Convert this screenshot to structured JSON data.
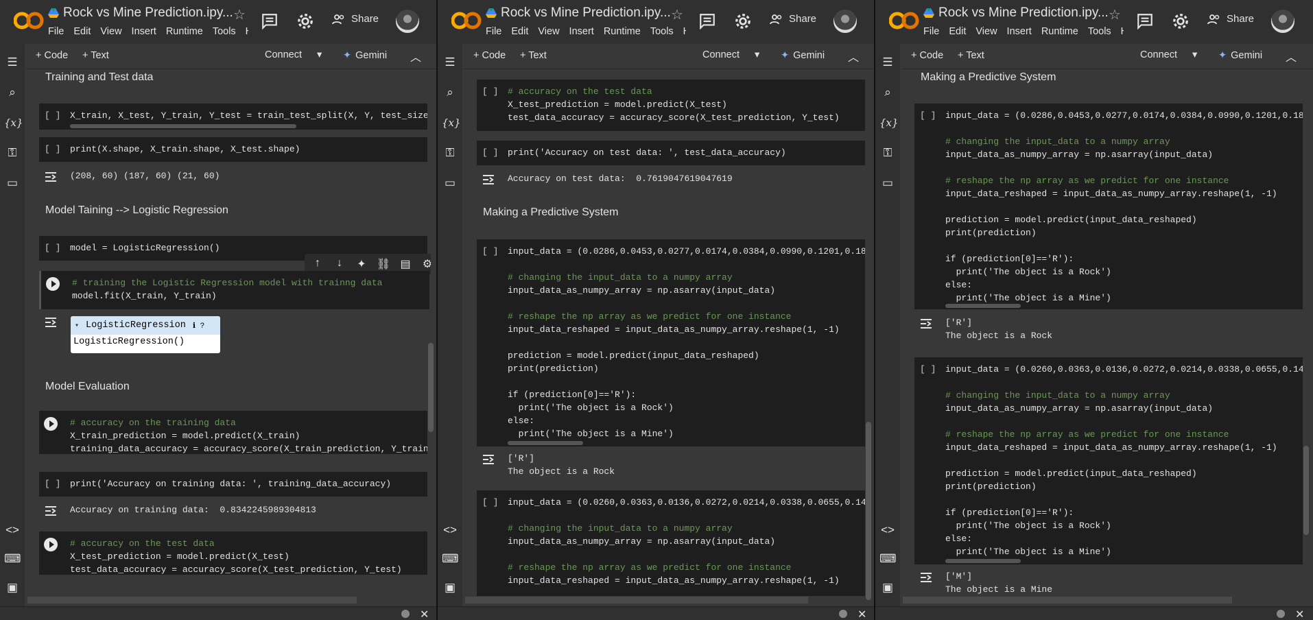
{
  "app": {
    "title": "Rock vs Mine Prediction.ipy...",
    "menu": [
      "File",
      "Edit",
      "View",
      "Insert",
      "Runtime",
      "Tools",
      "H"
    ],
    "share_label": "Share",
    "add_code": "+ Code",
    "add_text": "+ Text",
    "connect": "Connect",
    "gemini": "Gemini"
  },
  "panel1": {
    "sections": [
      "Training and Test data",
      "Model Taining --> Logistic Regression",
      "Model Evaluation"
    ],
    "cells": [
      {
        "bracket": "[ ]",
        "line1": "X_train, X_test, Y_train, Y_test = train_test_split(X, Y, test_size"
      },
      {
        "bracket": "[ ]",
        "line1": "print(X.shape, X_train.shape, X_test.shape)",
        "output": "(208, 60) (187, 60) (21, 60)"
      },
      {
        "bracket": "[ ]",
        "line1": "model = LogisticRegression()"
      },
      {
        "comment": "# training the Logistic Regression model with trainng data",
        "line1": "model.fit(X_train, Y_train)"
      },
      {
        "comment": "# accuracy on the training data",
        "line1": "X_train_prediction = model.predict(X_train)",
        "line2": "training_data_accuracy = accuracy_score(X_train_prediction, Y_train"
      },
      {
        "bracket": "[ ]",
        "line1": "print('Accuracy on training data: ', training_data_accuracy)",
        "output": "Accuracy on training data:  0.8342245989304813"
      },
      {
        "comment": "# accuracy on the test data",
        "line1": "X_test_prediction = model.predict(X_test)",
        "line2": "test_data_accuracy = accuracy_score(X_test_prediction, Y_test)"
      }
    ],
    "widget": {
      "title": "LogisticRegression",
      "body": "LogisticRegression()"
    }
  },
  "panel2": {
    "section": "Making a Predictive System",
    "cell1": {
      "bracket": "[ ]",
      "comment": "# accuracy on the test data",
      "line1": "X_test_prediction = model.predict(X_test)",
      "line2": "test_data_accuracy = accuracy_score(X_test_prediction, Y_test)"
    },
    "cell2": {
      "bracket": "[ ]",
      "line1": "print('Accuracy on test data: ', test_data_accuracy)",
      "output": "Accuracy on test data:  0.7619047619047619"
    },
    "cell3": {
      "bracket": "[ ]",
      "input": "input_data = (0.0286,0.0453,0.0277,0.0174,0.0384,0.0990,0.1201,0.183",
      "output1": "['R']",
      "output2": "The object is a Rock"
    },
    "cell4": {
      "bracket": "[ ]",
      "input": "input_data = (0.0260,0.0363,0.0136,0.0272,0.0214,0.0338,0.0655,0.140"
    }
  },
  "panel3": {
    "section": "Making a Predictive System",
    "cell1": {
      "bracket": "[ ]",
      "input": "input_data = (0.0286,0.0453,0.0277,0.0174,0.0384,0.0990,0.1201,0.183",
      "output1": "['R']",
      "output2": "The object is a Rock"
    },
    "cell2": {
      "bracket": "[ ]",
      "input": "input_data = (0.0260,0.0363,0.0136,0.0272,0.0214,0.0338,0.0655,0.140",
      "output1": "['M']",
      "output2": "The object is a Mine"
    }
  },
  "predict_code": {
    "c1": "# changing the input_data to a numpy array",
    "l1": "input_data_as_numpy_array = np.asarray(input_data)",
    "c2": "# reshape the np array as we predict for one instance",
    "l2": "input_data_reshaped = input_data_as_numpy_array.reshape(1, -1)",
    "l3": "prediction = model.predict(input_data_reshaped)",
    "l4": "print(prediction)",
    "l5": "if (prediction[0]=='R'):",
    "l6": "  print('The object is a Rock')",
    "l7": "else:",
    "l8": "  print('The object is a Mine')"
  },
  "colors": {
    "panel_bg": "#383838",
    "cell_bg": "#1e1e1e",
    "header_bg": "#303030",
    "comment": "#6a9955",
    "string": "#ce9178",
    "keyword": "#c586c0"
  }
}
